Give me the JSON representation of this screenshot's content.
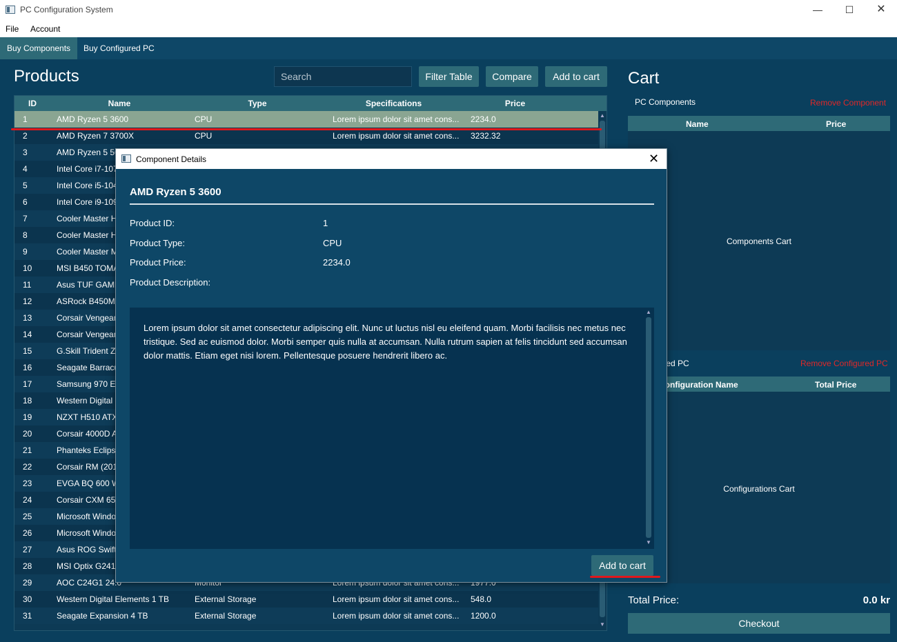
{
  "window": {
    "title": "PC Configuration System"
  },
  "menu": [
    "File",
    "Account"
  ],
  "tabs": [
    "Buy Components",
    "Buy Configured PC"
  ],
  "products": {
    "heading": "Products",
    "search_placeholder": "Search",
    "buttons": {
      "filter": "Filter Table",
      "compare": "Compare",
      "add": "Add to cart"
    },
    "columns": [
      "ID",
      "Name",
      "Type",
      "Specifications",
      "Price"
    ],
    "rows": [
      {
        "id": "1",
        "name": "AMD Ryzen 5 3600",
        "type": "CPU",
        "spec": "Lorem ipsum dolor sit amet cons...",
        "price": "2234.0"
      },
      {
        "id": "2",
        "name": "AMD Ryzen 7 3700X",
        "type": "CPU",
        "spec": "Lorem ipsum dolor sit amet cons...",
        "price": "3232.32"
      },
      {
        "id": "3",
        "name": "AMD Ryzen 5 5600X",
        "type": "",
        "spec": "",
        "price": ""
      },
      {
        "id": "4",
        "name": "Intel Core i7-10700K",
        "type": "",
        "spec": "",
        "price": ""
      },
      {
        "id": "5",
        "name": "Intel Core i5-10400F",
        "type": "",
        "spec": "",
        "price": ""
      },
      {
        "id": "6",
        "name": "Intel Core i9-10900K",
        "type": "",
        "spec": "",
        "price": ""
      },
      {
        "id": "7",
        "name": "Cooler Master Hyper 212",
        "type": "",
        "spec": "",
        "price": ""
      },
      {
        "id": "8",
        "name": "Cooler Master Hyper 212",
        "type": "",
        "spec": "",
        "price": ""
      },
      {
        "id": "9",
        "name": "Cooler Master MasterLiquid",
        "type": "",
        "spec": "",
        "price": ""
      },
      {
        "id": "10",
        "name": "MSI B450 TOMAHAWK",
        "type": "",
        "spec": "",
        "price": ""
      },
      {
        "id": "11",
        "name": "Asus TUF GAMING",
        "type": "",
        "spec": "",
        "price": ""
      },
      {
        "id": "12",
        "name": "ASRock B450M Pro",
        "type": "",
        "spec": "",
        "price": ""
      },
      {
        "id": "13",
        "name": "Corsair Vengeance",
        "type": "",
        "spec": "",
        "price": ""
      },
      {
        "id": "14",
        "name": "Corsair Vengeance",
        "type": "",
        "spec": "",
        "price": ""
      },
      {
        "id": "15",
        "name": "G.Skill Trident Z",
        "type": "",
        "spec": "",
        "price": ""
      },
      {
        "id": "16",
        "name": "Seagate Barracuda",
        "type": "",
        "spec": "",
        "price": ""
      },
      {
        "id": "17",
        "name": "Samsung 970 Evo",
        "type": "",
        "spec": "",
        "price": ""
      },
      {
        "id": "18",
        "name": "Western Digital",
        "type": "",
        "spec": "",
        "price": ""
      },
      {
        "id": "19",
        "name": "NZXT H510 ATX",
        "type": "",
        "spec": "",
        "price": ""
      },
      {
        "id": "20",
        "name": "Corsair 4000D Airflow",
        "type": "",
        "spec": "",
        "price": ""
      },
      {
        "id": "21",
        "name": "Phanteks Eclipse",
        "type": "",
        "spec": "",
        "price": ""
      },
      {
        "id": "22",
        "name": "Corsair RM (2019)",
        "type": "",
        "spec": "",
        "price": ""
      },
      {
        "id": "23",
        "name": "EVGA BQ 600 W",
        "type": "",
        "spec": "",
        "price": ""
      },
      {
        "id": "24",
        "name": "Corsair CXM 650",
        "type": "",
        "spec": "",
        "price": ""
      },
      {
        "id": "25",
        "name": "Microsoft Windows",
        "type": "",
        "spec": "",
        "price": ""
      },
      {
        "id": "26",
        "name": "Microsoft Windows",
        "type": "",
        "spec": "",
        "price": ""
      },
      {
        "id": "27",
        "name": "Asus ROG Swift",
        "type": "",
        "spec": "",
        "price": ""
      },
      {
        "id": "28",
        "name": "MSI Optix G241",
        "type": "",
        "spec": "",
        "price": ""
      },
      {
        "id": "29",
        "name": "AOC C24G1 24.0",
        "type": "Monitor",
        "spec": "Lorem ipsum dolor sit amet cons...",
        "price": "1977.0"
      },
      {
        "id": "30",
        "name": "Western Digital Elements 1 TB",
        "type": "External Storage",
        "spec": "Lorem ipsum dolor sit amet cons...",
        "price": "548.0"
      },
      {
        "id": "31",
        "name": "Seagate Expansion 4 TB",
        "type": "External Storage",
        "spec": "Lorem ipsum dolor sit amet cons...",
        "price": "1200.0"
      }
    ]
  },
  "cart": {
    "heading": "Cart",
    "components_label": "PC Components",
    "remove_component": "Remove Component",
    "components_cols": [
      "Name",
      "Price"
    ],
    "components_empty": "Components Cart",
    "configured_label": "Configured PC",
    "remove_configured": "Remove Configured PC",
    "configured_cols": [
      "Configuration Name",
      "Total Price"
    ],
    "configured_empty": "Configurations Cart",
    "total_label": "Total Price:",
    "total_value": "0.0 kr",
    "checkout": "Checkout"
  },
  "dialog": {
    "title": "Component Details",
    "heading": "AMD Ryzen 5 3600",
    "id_label": "Product ID:",
    "id_value": "1",
    "type_label": "Product Type:",
    "type_value": "CPU",
    "price_label": "Product Price:",
    "price_value": "2234.0",
    "desc_label": "Product Description:",
    "description": "Lorem ipsum dolor sit amet consectetur adipiscing elit. Nunc ut luctus nisl eu eleifend quam. Morbi facilisis nec metus nec tristique. Sed ac euismod dolor. Morbi semper quis nulla at accumsan. Nulla rutrum sapien at felis tincidunt sed accumsan dolor mattis. Etiam eget nisi lorem. Pellentesque posuere hendrerit libero ac.",
    "add_button": "Add to cart"
  },
  "colors": {
    "accent": "#2e6a77",
    "background": "#0e4767",
    "danger": "#e02828",
    "highlight_line": "#e0181c"
  }
}
